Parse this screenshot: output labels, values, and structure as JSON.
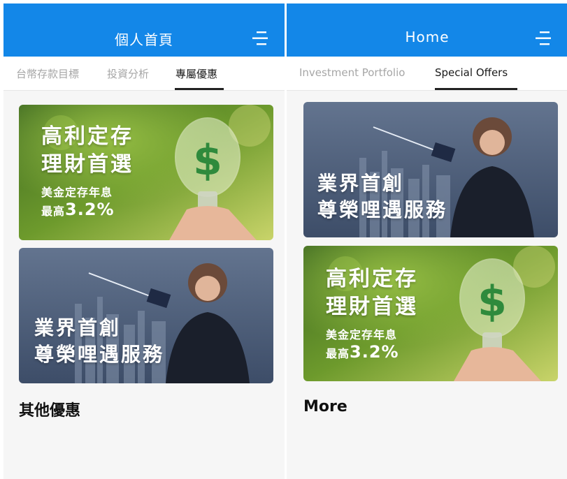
{
  "left_screen": {
    "header": {
      "title": "個人首頁",
      "menu_icon": "menu-icon"
    },
    "tabs": [
      {
        "label": "台幣存款目標",
        "active": false
      },
      {
        "label": "投資分析",
        "active": false
      },
      {
        "label": "專屬優惠",
        "active": true
      }
    ],
    "banners": [
      {
        "type": "deposit",
        "line1": "高利定存",
        "line2": "理財首選",
        "sub1": "美金定存年息",
        "sub2_prefix": "最高",
        "sub2_value": "3.2%"
      },
      {
        "type": "vip",
        "line1": "業界首創",
        "line2": "尊榮哩遇服務"
      }
    ],
    "section_title": "其他優惠"
  },
  "right_screen": {
    "header": {
      "title": "Home",
      "menu_icon": "menu-icon"
    },
    "tabs": [
      {
        "label": "Investment Portfolio",
        "active": false
      },
      {
        "label": "Special Offers",
        "active": true
      }
    ],
    "banners": [
      {
        "type": "vip",
        "line1": "業界首創",
        "line2": "尊榮哩遇服務"
      },
      {
        "type": "deposit",
        "line1": "高利定存",
        "line2": "理財首選",
        "sub1": "美金定存年息",
        "sub2_prefix": "最高",
        "sub2_value": "3.2%"
      }
    ],
    "section_title": "More"
  },
  "colors": {
    "header_blue": "#1387e8",
    "active_tab": "#1a1a1a",
    "inactive_tab": "#a6a6a6"
  }
}
